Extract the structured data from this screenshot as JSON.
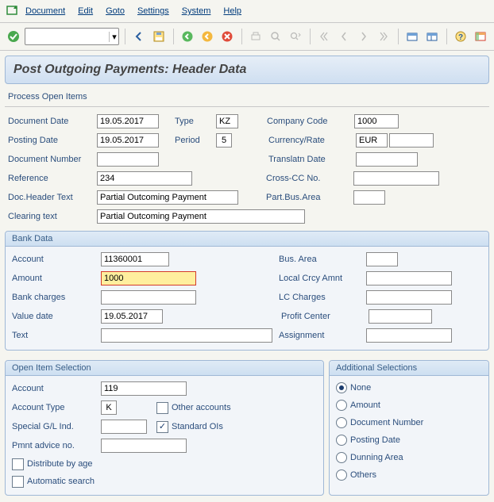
{
  "menu": {
    "document": "Document",
    "edit": "Edit",
    "goto": "Goto",
    "settings": "Settings",
    "system": "System",
    "help": "Help"
  },
  "title": "Post Outgoing Payments: Header Data",
  "sub_action": "Process Open Items",
  "head": {
    "labels": {
      "doc_date": "Document Date",
      "posting_date": "Posting Date",
      "doc_no": "Document Number",
      "reference": "Reference",
      "header_text": "Doc.Header Text",
      "clearing": "Clearing text",
      "type": "Type",
      "period": "Period",
      "company": "Company Code",
      "currency": "Currency/Rate",
      "trans_date": "Translatn Date",
      "cross": "Cross-CC No.",
      "part": "Part.Bus.Area"
    },
    "doc_date": "19.05.2017",
    "posting_date": "19.05.2017",
    "doc_no": "",
    "reference": "234",
    "header_text": "Partial Outcoming Payment",
    "clearing": "Partial Outcoming Payment",
    "type": "KZ",
    "period": "5",
    "company": "1000",
    "currency": "EUR",
    "currency2": "",
    "trans_date": "",
    "cross": "",
    "part": ""
  },
  "bank": {
    "title": "Bank Data",
    "labels": {
      "account": "Account",
      "amount": "Amount",
      "charges": "Bank charges",
      "value_date": "Value date",
      "text": "Text",
      "bus_area": "Bus. Area",
      "local": "Local Crcy Amnt",
      "lc": "LC Charges",
      "profit": "Profit Center",
      "assign": "Assignment"
    },
    "account": "11360001",
    "amount": "1000",
    "charges": "",
    "value_date": "19.05.2017",
    "text": "",
    "bus_area": "",
    "local": "",
    "lc": "",
    "profit": "",
    "assign": ""
  },
  "open": {
    "title": "Open Item Selection",
    "labels": {
      "account": "Account",
      "acct_type": "Account Type",
      "other": "Other accounts",
      "special": "Special G/L Ind.",
      "standard": "Standard OIs",
      "pmnt": "Pmnt advice no.",
      "dist": "Distribute by age",
      "auto": "Automatic search"
    },
    "account": "119",
    "acct_type": "K",
    "special": "",
    "pmnt": "",
    "other_checked": false,
    "standard_checked": true,
    "dist_checked": false,
    "auto_checked": false
  },
  "add": {
    "title": "Additional Selections",
    "options": [
      "None",
      "Amount",
      "Document Number",
      "Posting Date",
      "Dunning Area",
      "Others"
    ],
    "selected": 0
  }
}
